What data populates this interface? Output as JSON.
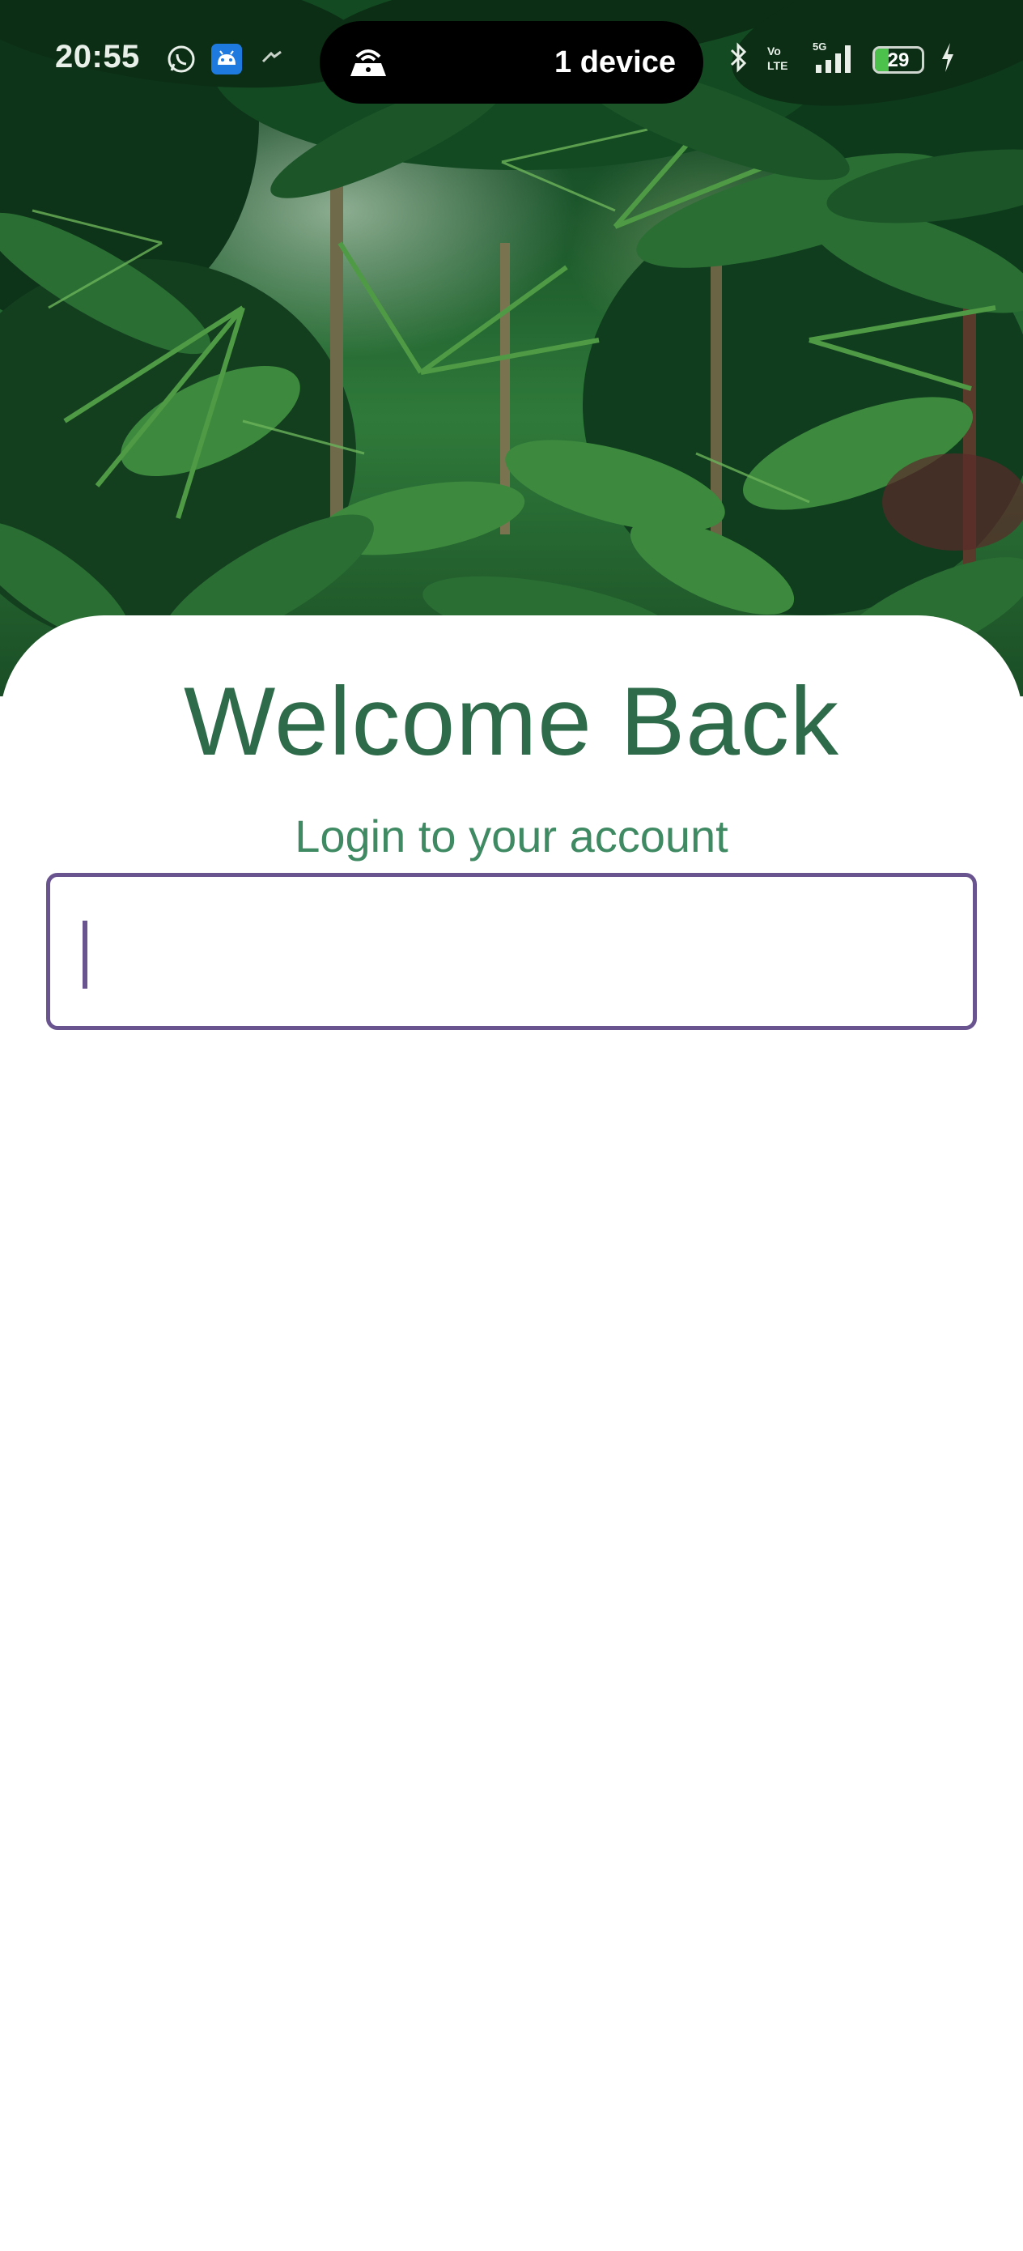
{
  "status_bar": {
    "time": "20:55",
    "notification_icons": [
      "whatsapp-icon",
      "android-app-icon",
      "sync-icon"
    ],
    "hotspot_pill": {
      "icon": "hotspot-icon",
      "text": "1 device"
    },
    "right_icons": [
      "bluetooth-icon",
      "volte-icon",
      "5g-signal-icon"
    ],
    "battery": {
      "level": 29,
      "label": "29",
      "charging": true
    }
  },
  "hero": {
    "description_icon": "jungle-photo"
  },
  "login": {
    "title": "Welcome Back",
    "subtitle": "Login to your account",
    "input_value": ""
  },
  "colors": {
    "title": "#2e6b4a",
    "subtitle": "#3f8a63",
    "input_border": "#6a5490",
    "battery_fill": "#4cc24c"
  }
}
